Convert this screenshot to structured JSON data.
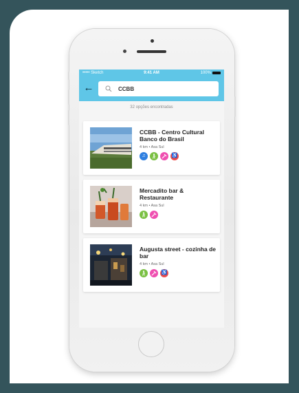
{
  "status_bar": {
    "carrier": "••••• Sketch",
    "time": "9:41 AM",
    "battery": "100%"
  },
  "search": {
    "query": "CCBB"
  },
  "results_count": "32 opções encontradas",
  "results": [
    {
      "title": "CCBB - Centro Cultural Banco do Brasil",
      "meta": "4 km • Asa Sul",
      "tags": [
        {
          "icon": "music-icon",
          "color": "#2f7fe0",
          "glyph": "♫"
        },
        {
          "icon": "walking-icon",
          "color": "#7ac043",
          "glyph": "Ὣ6"
        },
        {
          "icon": "pin-icon",
          "color": "#ef4fb0",
          "glyph": "❀"
        },
        {
          "icon": "accessibility-icon",
          "color": "#ef4d4d",
          "glyph": "♿"
        }
      ]
    },
    {
      "title": "Mercadito bar & Restaurante",
      "meta": "4 km • Asa Sul",
      "tags": [
        {
          "icon": "walking-icon",
          "color": "#7ac043",
          "glyph": ""
        },
        {
          "icon": "pin-icon",
          "color": "#ef4fb0",
          "glyph": ""
        }
      ]
    },
    {
      "title": "Augusta street - cozinha de bar",
      "meta": "4 km • Asa Sul",
      "tags": [
        {
          "icon": "walking-icon",
          "color": "#7ac043",
          "glyph": ""
        },
        {
          "icon": "pin-icon",
          "color": "#ef4fb0",
          "glyph": ""
        },
        {
          "icon": "accessibility-icon",
          "color": "#ef4d4d",
          "glyph": ""
        }
      ]
    }
  ],
  "colors": {
    "accent": "#5fc6e7",
    "outer_frame": "#34545b"
  }
}
